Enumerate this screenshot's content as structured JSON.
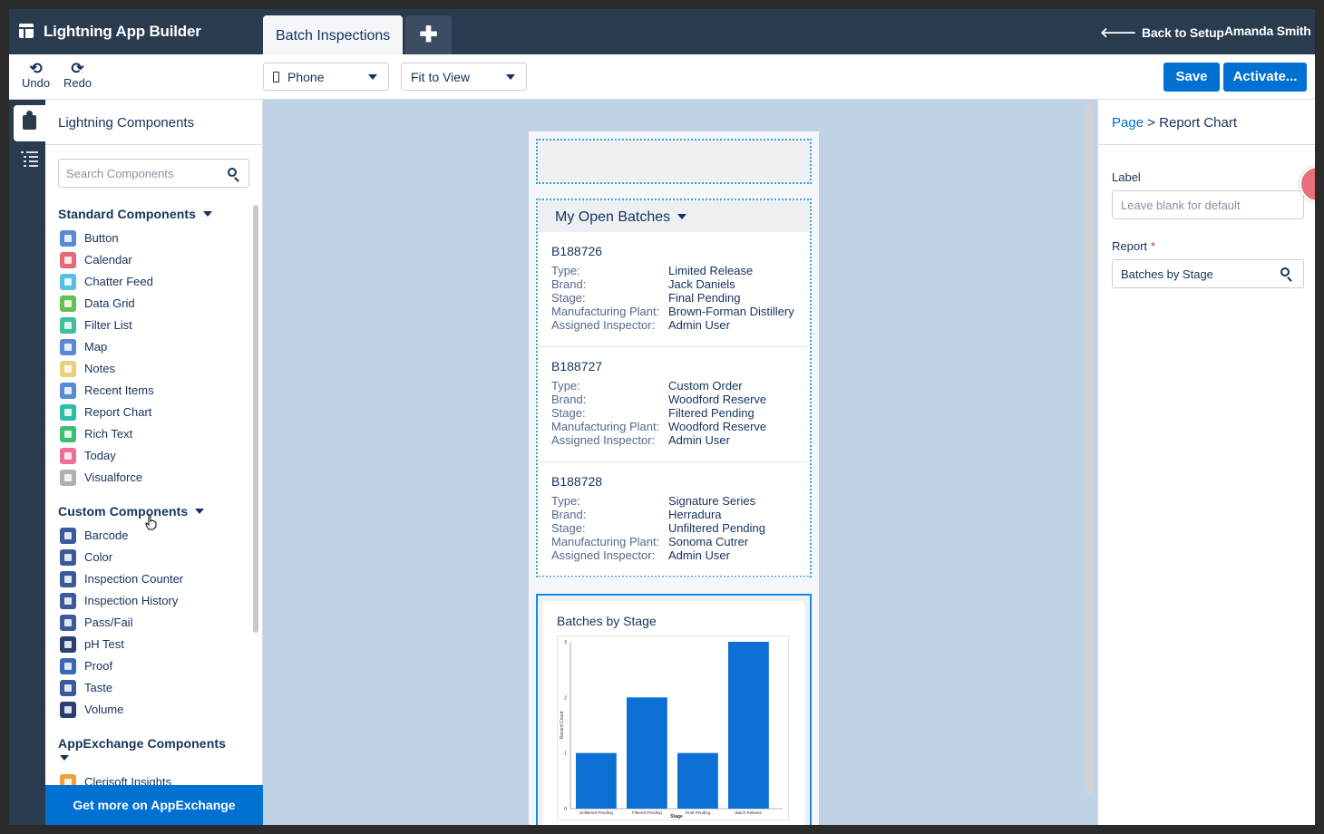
{
  "app": {
    "title": "Lightning App Builder",
    "active_tab": "Batch Inspections",
    "add_tab": "✚",
    "back_to_setup": "Back to Setup",
    "user": "Amanda Smith"
  },
  "toolbar": {
    "undo": "Undo",
    "redo": "Redo",
    "device": "Phone",
    "zoom": "Fit to View",
    "save": "Save",
    "activate": "Activate..."
  },
  "components_panel": {
    "title": "Lightning Components",
    "search_placeholder": "Search Components",
    "standard_title": "Standard Components",
    "standard": [
      {
        "label": "Button",
        "color": "#5a8ad6"
      },
      {
        "label": "Calendar",
        "color": "#e86a78"
      },
      {
        "label": "Chatter Feed",
        "color": "#56c0e0"
      },
      {
        "label": "Data Grid",
        "color": "#62c152"
      },
      {
        "label": "Filter List",
        "color": "#3fbf9a"
      },
      {
        "label": "Map",
        "color": "#5a8ad6"
      },
      {
        "label": "Notes",
        "color": "#ead27a"
      },
      {
        "label": "Recent Items",
        "color": "#5a8ad6"
      },
      {
        "label": "Report Chart",
        "color": "#2cbfa8"
      },
      {
        "label": "Rich Text",
        "color": "#3fbf70"
      },
      {
        "label": "Today",
        "color": "#ef6e9c"
      },
      {
        "label": "Visualforce",
        "color": "#b0b0b0"
      }
    ],
    "custom_title": "Custom Components",
    "custom": [
      {
        "label": "Barcode",
        "color": "#3a5a9c"
      },
      {
        "label": "Color",
        "color": "#3a5a9c"
      },
      {
        "label": "Inspection Counter",
        "color": "#3a5a9c"
      },
      {
        "label": "Inspection History",
        "color": "#3a5a9c"
      },
      {
        "label": "Pass/Fail",
        "color": "#3a5a9c"
      },
      {
        "label": "pH Test",
        "color": "#2a3f73"
      },
      {
        "label": "Proof",
        "color": "#3a6ab5"
      },
      {
        "label": "Taste",
        "color": "#3a5a9c"
      },
      {
        "label": "Volume",
        "color": "#2a3f73"
      }
    ],
    "appexchange_title": "AppExchange Components",
    "appexchange": [
      {
        "label": "Clerisoft Insights",
        "color": "#f0a23a"
      }
    ],
    "get_more": "Get more on AppExchange"
  },
  "canvas": {
    "list_title": "My Open Batches",
    "field_labels": [
      "Type:",
      "Brand:",
      "Stage:",
      "Manufacturing Plant:",
      "Assigned Inspector:"
    ],
    "batches": [
      {
        "id": "B188726",
        "values": [
          "Limited Release",
          "Jack Daniels",
          "Final Pending",
          "Brown-Forman Distillery",
          "Admin User"
        ]
      },
      {
        "id": "B188727",
        "values": [
          "Custom Order",
          "Woodford Reserve",
          "Filtered Pending",
          "Woodford Reserve",
          "Admin User"
        ]
      },
      {
        "id": "B188728",
        "values": [
          "Signature Series",
          "Herradura",
          "Unfiltered Pending",
          "Sonoma Cutrer",
          "Admin User"
        ]
      }
    ],
    "chart_title": "Batches by Stage"
  },
  "chart_data": {
    "type": "bar",
    "title": "Batches by Stage",
    "categories": [
      "Unfiltered Pending",
      "Filtered Pending",
      "Final Pending",
      "Batch Release"
    ],
    "values": [
      1,
      2,
      1,
      3
    ],
    "xlabel": "Stage",
    "ylabel": "Record Count",
    "ylim": [
      0,
      3
    ],
    "yticks": [
      "0",
      "1",
      "2",
      "3"
    ],
    "bar_color": "#0b6fd3",
    "grid": false
  },
  "properties": {
    "crumb_link": "Page",
    "crumb_sep": ">",
    "crumb_current": "Report Chart",
    "label_title": "Label",
    "label_placeholder": "Leave blank for default",
    "report_title": "Report",
    "report_required": "*",
    "report_value": "Batches by Stage"
  }
}
